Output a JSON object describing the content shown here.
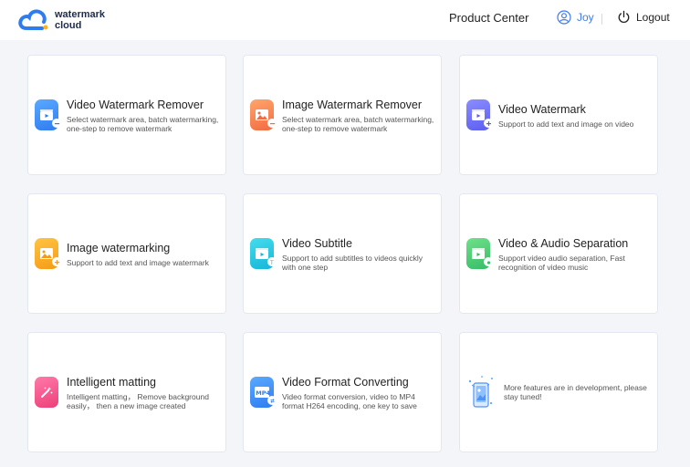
{
  "header": {
    "logo_line1": "watermark",
    "logo_line2": "cloud",
    "product_center": "Product Center",
    "user_name": "Joy",
    "logout": "Logout"
  },
  "cards": [
    {
      "title": "Video Watermark Remover",
      "desc": "Select watermark area, batch watermarking, one-step to remove watermark",
      "icon": "video-clapper-icon"
    },
    {
      "title": "Image Watermark Remover",
      "desc": "Select watermark area, batch watermarking, one-step to remove watermark",
      "icon": "image-icon"
    },
    {
      "title": "Video Watermark",
      "desc": "Support to add text and image on video",
      "icon": "video-clapper-icon"
    },
    {
      "title": "Image watermarking",
      "desc": "Support to add text and image watermark",
      "icon": "image-icon"
    },
    {
      "title": "Video Subtitle",
      "desc": "Support to add subtitles to videos quickly with one step",
      "icon": "video-clapper-icon"
    },
    {
      "title": "Video & Audio Separation",
      "desc": "Support video audio separation, Fast recognition of video music",
      "icon": "video-clapper-icon"
    },
    {
      "title": "Intelligent matting",
      "desc": "Intelligent matting， Remove background easily， then a new image created",
      "icon": "magic-wand-icon"
    },
    {
      "title": "Video Format Converting",
      "desc": "Video format conversion, video to MP4 format H264 encoding, one key to save",
      "icon": "mp4-file-icon",
      "icon_label": "MP4"
    },
    {
      "desc": "More features are in development, please stay tuned!",
      "icon": "phone-features-icon"
    }
  ],
  "colors": {
    "accent": "#3d7cf5",
    "background": "#f3f5f9"
  }
}
